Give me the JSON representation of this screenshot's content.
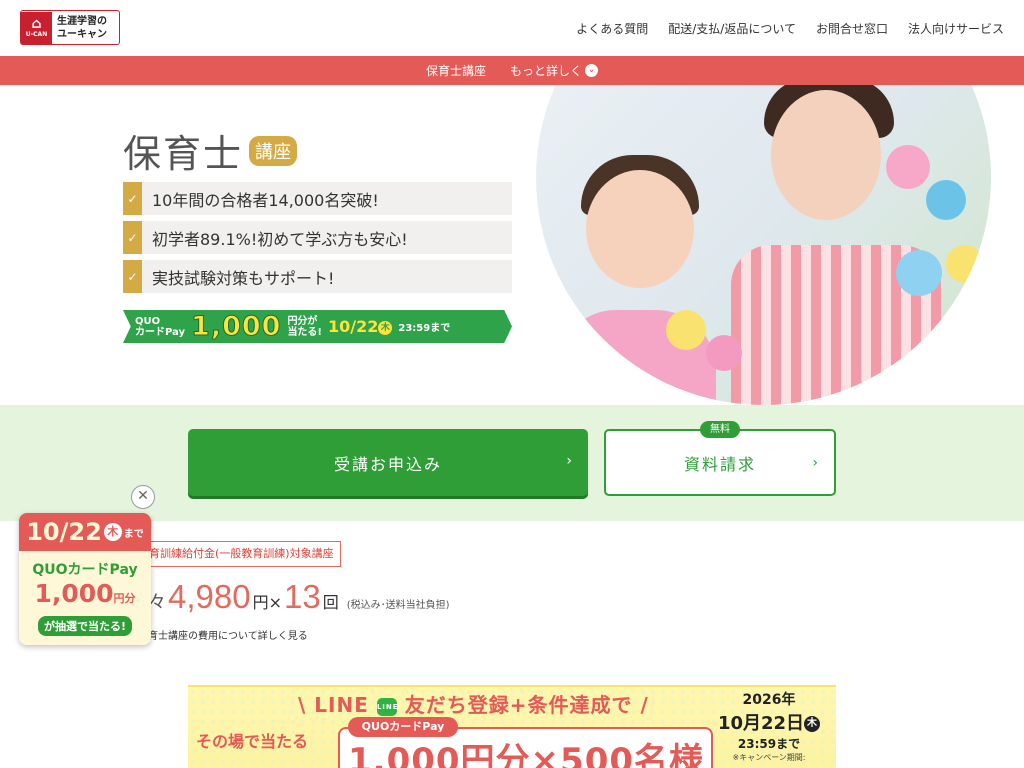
{
  "header": {
    "logo_brand": "U-CAN",
    "logo_line1": "生涯学習の",
    "logo_line2": "ユーキャン",
    "nav": [
      "よくある質問",
      "配送/支払/返品について",
      "お問合せ窓口",
      "法人向けサービス"
    ]
  },
  "subnav": {
    "course": "保育士講座",
    "more": "もっと詳しく"
  },
  "hero": {
    "title": "保育士",
    "title_tag": "講座",
    "points": [
      "10年間の合格者14,000名突破!",
      "初学者89.1%!初めて学ぶ方も安心!",
      "実技試験対策もサポート!"
    ],
    "banner": {
      "label_line1": "QUO",
      "label_line2": "カードPay",
      "amount": "1,000",
      "yen_line1": "円分が",
      "yen_line2": "当たる!",
      "date": "10/22",
      "weekday": "木",
      "until": "23:59まで"
    }
  },
  "cta": {
    "apply": "受講お申込み",
    "request": "資料請求",
    "free_badge": "無料"
  },
  "price": {
    "subsidy": "育訓練給付金(一般教育訓練)対象講座",
    "prefix": "々",
    "amount": "4,980",
    "unit": "円×",
    "count": "13",
    "count_unit": "回",
    "note": "(税込み･送料当社負担)",
    "link": "育士講座の費用について詳しく見る"
  },
  "float_badge": {
    "date": "10/22",
    "weekday": "木",
    "until": "まで",
    "line1": "QUOカードPay",
    "amount": "1,000",
    "amount_unit": "円分",
    "line3": "が抽選で当たる!"
  },
  "line_banner": {
    "head_pre": "\\ LINE",
    "head_icon": "LINE",
    "head_post": "友だち登録+条件達成で /",
    "pill": "QUOカードPay",
    "big": "1,000円分×500名様",
    "left": "その場で当たる",
    "year": "2026年",
    "month_day": "10月22日",
    "weekday": "木",
    "time": "23:59まで",
    "campaign": "※キャンペーン期間:"
  },
  "colors": {
    "brand_red": "#c8202f",
    "subnav_red": "#e35a57",
    "gold": "#d4aa45",
    "green": "#2f9e37",
    "band_green": "#e5f4dd"
  }
}
